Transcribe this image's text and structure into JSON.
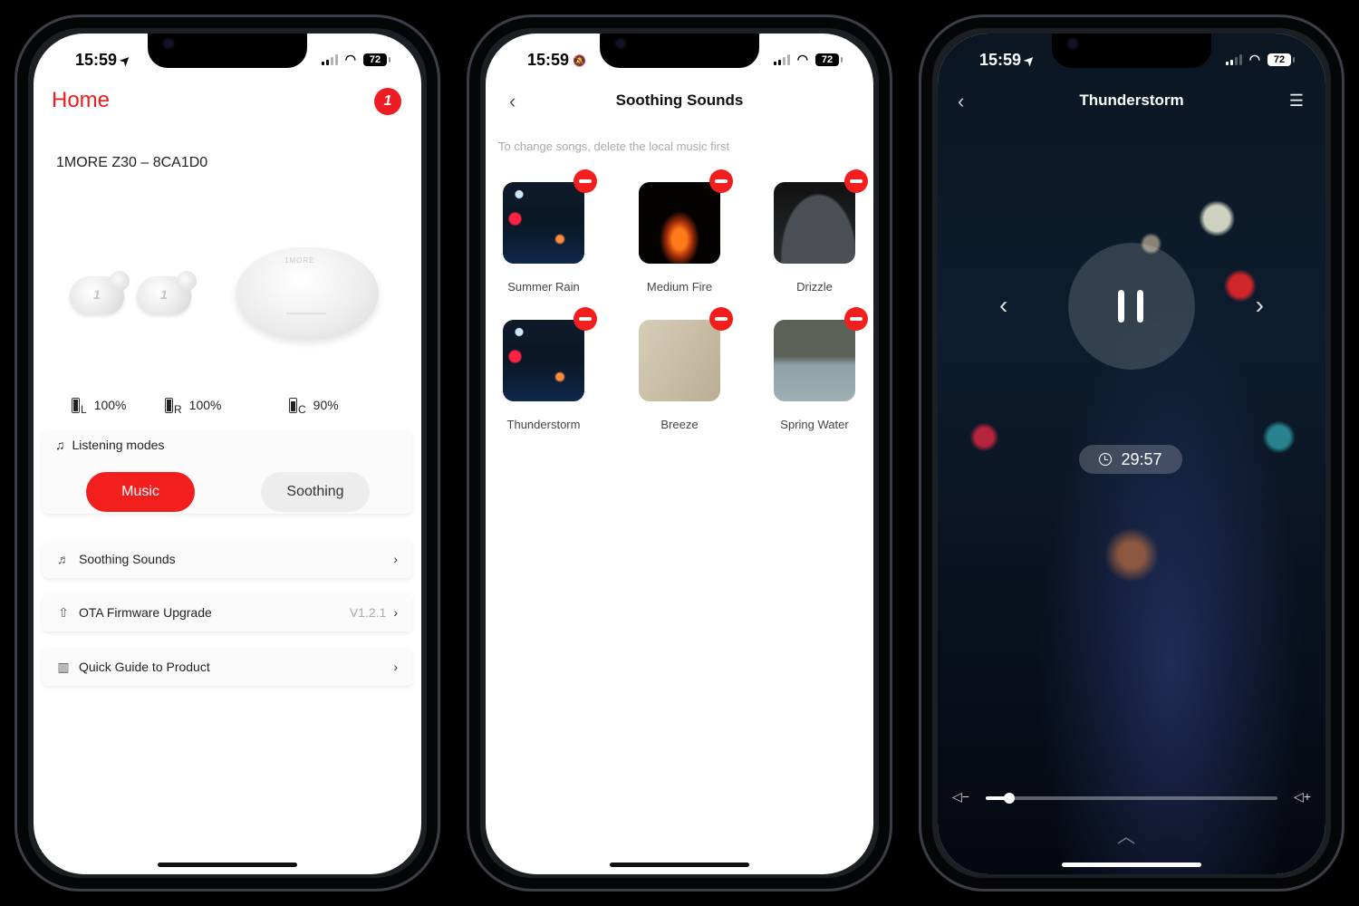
{
  "status_bar": {
    "time": "15:59",
    "battery": "72"
  },
  "screens": {
    "home": {
      "title": "Home",
      "brand_logo": "1",
      "device_name": "1MORE Z30 – 8CA1D0",
      "case_mark": "1MORE",
      "battery": [
        {
          "side": "L",
          "value": "100%"
        },
        {
          "side": "R",
          "value": "100%"
        },
        {
          "side": "C",
          "value": "90%"
        }
      ],
      "listening_modes": {
        "label": "Listening modes",
        "options": [
          "Music",
          "Soothing"
        ],
        "selected": "Music"
      },
      "menu": [
        {
          "icon": "music-note-icon",
          "label": "Soothing Sounds",
          "value": ""
        },
        {
          "icon": "upgrade-arrow-icon",
          "label": "OTA Firmware Upgrade",
          "value": "V1.2.1"
        },
        {
          "icon": "guide-book-icon",
          "label": "Quick Guide to Product",
          "value": ""
        }
      ]
    },
    "soothing": {
      "title": "Soothing Sounds",
      "hint": "To change songs, delete the local music first",
      "sounds": [
        {
          "name": "Summer Rain"
        },
        {
          "name": "Medium Fire"
        },
        {
          "name": "Drizzle"
        },
        {
          "name": "Thunderstorm"
        },
        {
          "name": "Breeze"
        },
        {
          "name": "Spring Water"
        }
      ]
    },
    "player": {
      "title": "Thunderstorm",
      "timer": "29:57",
      "volume_fraction": 0.08,
      "state": "playing"
    }
  },
  "icons": {
    "back": "‹",
    "chevron_right": "›",
    "menu": "☰",
    "prev": "‹",
    "next": "›",
    "vol_down": "🔈−",
    "vol_up": "🔈+",
    "up": "︿",
    "location": "➤",
    "mute": "🔕"
  }
}
